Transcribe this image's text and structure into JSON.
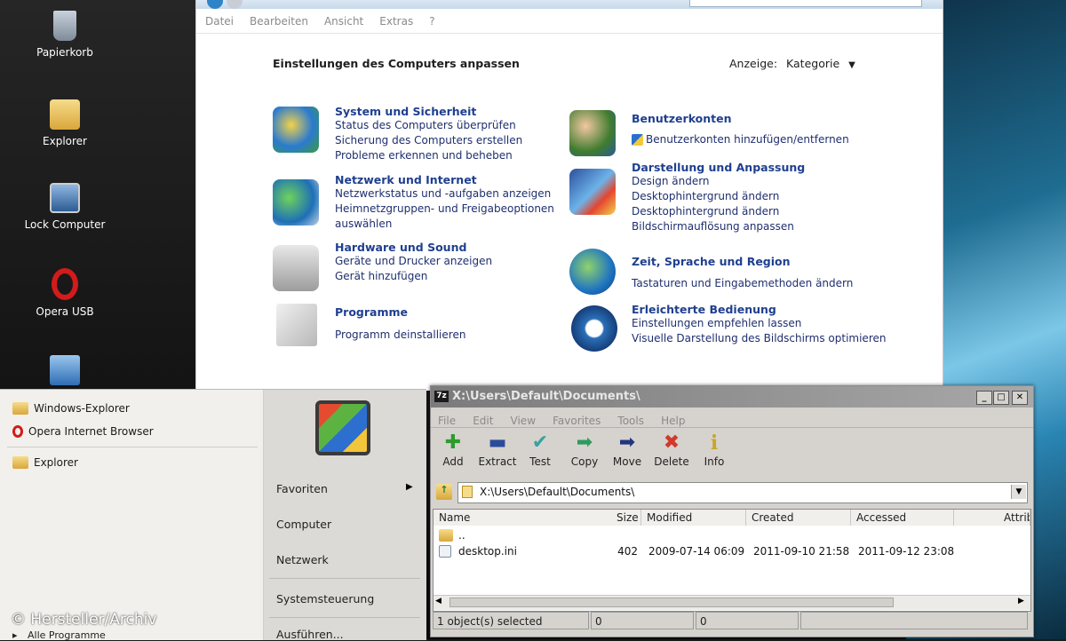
{
  "desktop": {
    "icons": [
      {
        "label": "Papierkorb",
        "icon": "recycle-bin-icon"
      },
      {
        "label": "Explorer",
        "icon": "folder-shortcut-icon"
      },
      {
        "label": "Lock Computer",
        "icon": "monitor-shortcut-icon"
      },
      {
        "label": "Opera USB",
        "icon": "opera-icon"
      }
    ]
  },
  "control_panel": {
    "menu": [
      "Datei",
      "Bearbeiten",
      "Ansicht",
      "Extras",
      "?"
    ],
    "heading": "Einstellungen des Computers anpassen",
    "view_label": "Anzeige:",
    "view_value": "Kategorie",
    "categories_left": [
      {
        "title": "System und Sicherheit",
        "icon": "shield-icon",
        "links": [
          "Status des Computers überprüfen",
          "Sicherung des Computers erstellen",
          "Probleme erkennen und beheben"
        ]
      },
      {
        "title": "Netzwerk und Internet",
        "icon": "network-globe-icon",
        "links": [
          "Netzwerkstatus und -aufgaben anzeigen",
          "Heimnetzgruppen- und Freigabeoptionen",
          "auswählen"
        ]
      },
      {
        "title": "Hardware und Sound",
        "icon": "printer-speaker-icon",
        "links": [
          "Geräte und Drucker anzeigen",
          "Gerät hinzufügen"
        ]
      },
      {
        "title": "Programme",
        "icon": "programs-disc-icon",
        "links": [
          "Programm deinstallieren"
        ]
      }
    ],
    "categories_right": [
      {
        "title": "Benutzerkonten",
        "icon": "users-icon",
        "links": [
          "Benutzerkonten hinzufügen/entfernen"
        ]
      },
      {
        "title": "Darstellung und Anpassung",
        "icon": "monitor-paint-icon",
        "links": [
          "Design ändern",
          "Desktophintergrund ändern",
          "Desktophintergrund ändern",
          "Bildschirmauflösung anpassen"
        ]
      },
      {
        "title": "Zeit, Sprache und Region",
        "icon": "globe-clock-icon",
        "links": [
          "Tastaturen und Eingabemethoden ändern"
        ]
      },
      {
        "title": "Erleichterte Bedienung",
        "icon": "accessibility-icon",
        "links": [
          "Einstellungen empfehlen lassen",
          "Visuelle Darstellung des Bildschirms optimieren"
        ]
      }
    ]
  },
  "start_menu": {
    "left_items": [
      {
        "label": "Windows-Explorer",
        "icon": "folder-icon"
      },
      {
        "label": "Opera Internet Browser",
        "icon": "opera-icon"
      },
      {
        "label": "Explorer",
        "icon": "folder-icon"
      }
    ],
    "all_programs": "Alle Programme",
    "right_items": [
      "Favoriten",
      "Computer",
      "Netzwerk",
      "Systemsteuerung",
      "Ausführen..."
    ]
  },
  "sevenzip": {
    "title": "X:\\Users\\Default\\Documents\\",
    "app_badge": "7z",
    "menu": [
      "File",
      "Edit",
      "View",
      "Favorites",
      "Tools",
      "Help"
    ],
    "toolbar": [
      {
        "label": "Add",
        "icon": "plus-icon",
        "color": "#2e9b2e"
      },
      {
        "label": "Extract",
        "icon": "minus-icon",
        "color": "#2b4c9b"
      },
      {
        "label": "Test",
        "icon": "check-icon",
        "color": "#3aa0a0"
      },
      {
        "label": "Copy",
        "icon": "copy-arrow-icon",
        "color": "#2e9b5e"
      },
      {
        "label": "Move",
        "icon": "move-arrow-icon",
        "color": "#23357f"
      },
      {
        "label": "Delete",
        "icon": "delete-x-icon",
        "color": "#d03a2a"
      },
      {
        "label": "Info",
        "icon": "info-icon",
        "color": "#c9a52a"
      }
    ],
    "address": "X:\\Users\\Default\\Documents\\",
    "columns": [
      "Name",
      "Size",
      "Modified",
      "Created",
      "Accessed",
      "Attrib"
    ],
    "rows": [
      {
        "name": "..",
        "size": "",
        "modified": "",
        "created": "",
        "accessed": ""
      },
      {
        "name": "desktop.ini",
        "size": "402",
        "modified": "2009-07-14 06:09",
        "created": "2011-09-10 21:58",
        "accessed": "2011-09-12 23:08"
      }
    ],
    "status": {
      "selected": "1 object(s) selected",
      "size1": "0",
      "size2": "0"
    }
  },
  "watermark": "© Hersteller/Archiv"
}
